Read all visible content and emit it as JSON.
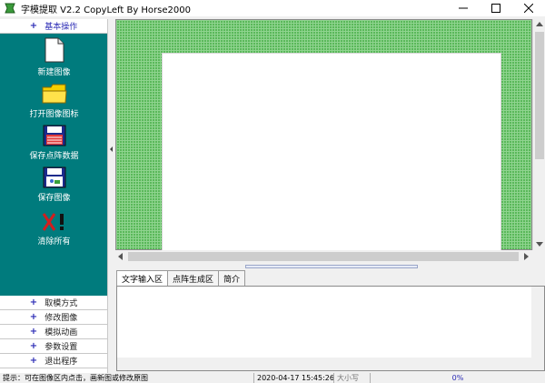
{
  "window": {
    "title": "字模提取 V2.2  CopyLeft By Horse2000",
    "icon": "app-green-icon",
    "controls": [
      "minimize-icon",
      "maximize-icon",
      "close-icon"
    ]
  },
  "left_panel": {
    "section_title": "基本操作",
    "tools": [
      {
        "label": "新建图像",
        "icon": "new-file-icon"
      },
      {
        "label": "打开图像图标",
        "icon": "folder-icon"
      },
      {
        "label": "保存点阵数据",
        "icon": "floppy-red-icon"
      },
      {
        "label": "保存图像",
        "icon": "floppy-blue-icon"
      },
      {
        "label": "清除所有",
        "icon": "clear-x-icon"
      }
    ],
    "categories": [
      "取模方式",
      "修改图像",
      "模拟动画",
      "参数设置",
      "退出程序"
    ]
  },
  "tabs": [
    "文字输入区",
    "点阵生成区",
    "简介"
  ],
  "status_bar": {
    "hint": "提示：可在图像区内点击，画新图或修改原图",
    "datetime": "2020-04-17 15:45:26",
    "caps": "大小写",
    "progress": "0%"
  },
  "colors": {
    "teal_panel": "#007b7d",
    "grid_green": "#5ab85a",
    "header_blue": "#2b2bb5"
  }
}
